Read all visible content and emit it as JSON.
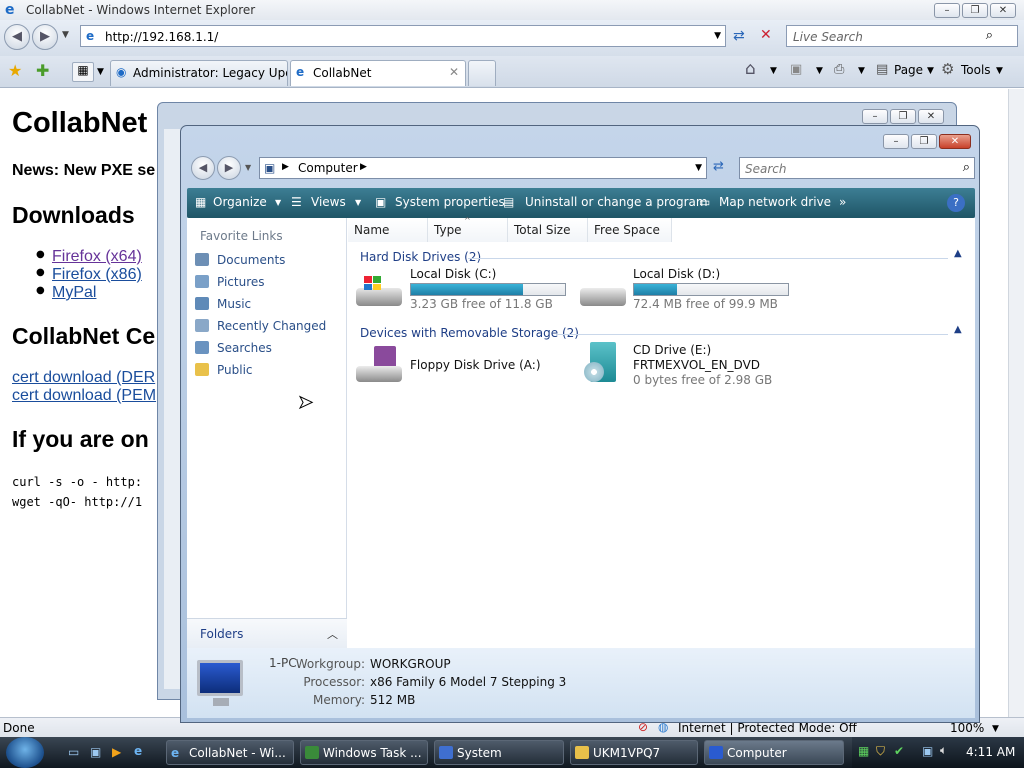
{
  "ie": {
    "title": "CollabNet - Windows Internet Explorer",
    "url": "http://192.168.1.1/",
    "search_placeholder": "Live Search",
    "tabs": [
      {
        "label": "Administrator: Legacy Upd..."
      },
      {
        "label": "CollabNet"
      }
    ],
    "toolbar": {
      "page": "Page",
      "tools": "Tools"
    },
    "status": {
      "left": "Done",
      "zone": "Internet | Protected Mode: Off",
      "zoom": "100%"
    }
  },
  "web": {
    "title": "CollabNet",
    "news": "News: New PXE se",
    "downloads": "Downloads",
    "links": [
      "Firefox (x64)",
      "Firefox (x86)",
      "MyPal"
    ],
    "cert_heading": "CollabNet Ce",
    "cert_links": [
      "cert download (DER",
      "cert download (PEM"
    ],
    "if_heading": "If you are on",
    "code": [
      "curl -s -o - http:",
      "wget -qO- http://1"
    ]
  },
  "explorer": {
    "address": "Computer",
    "search_placeholder": "Search",
    "toolbar": [
      "Organize",
      "Views",
      "System properties",
      "Uninstall or change a program",
      "Map network drive"
    ],
    "favorite_links_title": "Favorite Links",
    "favorite_links": [
      "Documents",
      "Pictures",
      "Music",
      "Recently Changed",
      "Searches",
      "Public"
    ],
    "folders_label": "Folders",
    "columns": [
      "Name",
      "Type",
      "Total Size",
      "Free Space"
    ],
    "groups": {
      "hdd": "Hard Disk Drives (2)",
      "removable": "Devices with Removable Storage (2)"
    },
    "drives": {
      "c": {
        "name": "Local Disk (C:)",
        "free": "3.23 GB free of 11.8 GB",
        "used_fraction": 0.73
      },
      "d": {
        "name": "Local Disk (D:)",
        "free": "72.4 MB free of 99.9 MB",
        "used_fraction": 0.28
      },
      "a": {
        "name": "Floppy Disk Drive (A:)"
      },
      "e": {
        "name": "CD Drive (E:)",
        "label": "FRTMEXVOL_EN_DVD",
        "free": "0 bytes free of 2.98 GB"
      }
    },
    "details": {
      "computer": "1-PC",
      "workgroup_label": "Workgroup:",
      "workgroup": "WORKGROUP",
      "processor_label": "Processor:",
      "processor": "x86 Family 6 Model 7 Stepping 3",
      "memory_label": "Memory:",
      "memory": "512 MB"
    }
  },
  "taskbar": {
    "tasks": [
      "CollabNet - Wi...",
      "Windows Task ...",
      "System",
      "UKM1VPQ7",
      "Computer"
    ],
    "clock": "4:11 AM"
  },
  "colors": {
    "explorer_toolbar": "#1f5566",
    "link": "#1a4d9c",
    "disk_bar": "#1f7fa7"
  }
}
